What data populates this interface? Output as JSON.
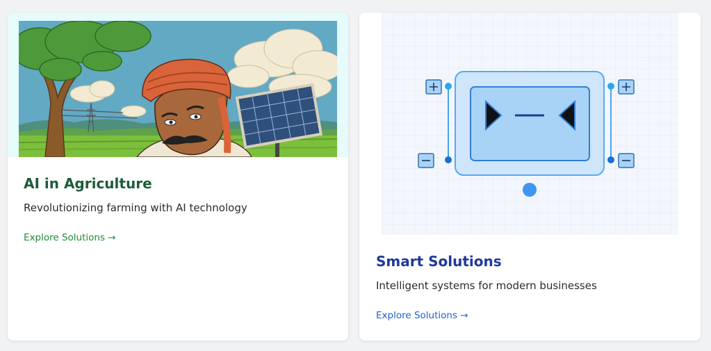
{
  "cards": [
    {
      "title": "AI in Agriculture",
      "description": "Revolutionizing farming with AI technology",
      "link_label": "Explore Solutions",
      "link_arrow": "→",
      "title_color": "#1d5c3b",
      "link_color": "#1f8a3a",
      "image": "farmer-with-solar-panel-illustration"
    },
    {
      "title": "Smart Solutions",
      "description": "Intelligent systems for modern businesses",
      "link_label": "Explore Solutions",
      "link_arrow": "→",
      "title_color": "#1f3a9c",
      "link_color": "#1f5fcf",
      "image": "node-diagram-illustration"
    }
  ]
}
